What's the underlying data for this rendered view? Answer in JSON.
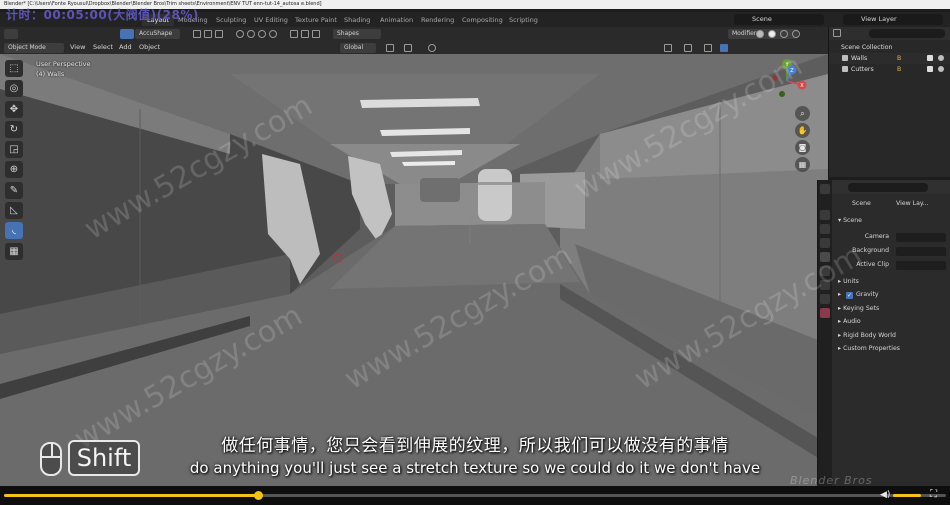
{
  "window": {
    "title": "Blender* [C:\\Users\\Fonte Ryousul\\Dropbox\\Blender\\Blender Bros\\Trim sheets\\Environment\\ENV TUT enn-tut-14_autosa e.blend]",
    "timer": "计时：00:05:00(大阀值)(28%)"
  },
  "workspaces": {
    "tabs": [
      "Layout",
      "Modeling",
      "Sculpting",
      "UV Editing",
      "Texture Paint",
      "Shading",
      "Animation",
      "Rendering",
      "Compositing",
      "Scripting"
    ],
    "active": "Layout",
    "scene_label": "Scene",
    "view_layer_label": "View Layer"
  },
  "viewport_header": {
    "mode": "Object Mode",
    "menus": [
      "View",
      "Select",
      "Add",
      "Object"
    ],
    "accushape": "AccuShape",
    "shapes": "Shapes",
    "orientation": "Global",
    "modifiers": "Modifiers"
  },
  "viewport": {
    "perspective": "User Perspective",
    "selection": "(4) Walls"
  },
  "tools": [
    "select-tool-icon",
    "cursor-tool-icon",
    "move-tool-icon",
    "rotate-tool-icon",
    "scale-tool-icon",
    "transform-tool-icon",
    "annotate-tool-icon",
    "measure-tool-icon",
    "boxcutter-tool-icon",
    "grid-tool-icon"
  ],
  "gizmo": {
    "y": "Y",
    "x": "X",
    "z": "Z"
  },
  "outliner": {
    "search_placeholder": "",
    "collection": "Scene Collection",
    "items": [
      {
        "label": "Walls",
        "badge": "B"
      },
      {
        "label": "Cutters",
        "badge": "B"
      }
    ]
  },
  "properties": {
    "breadcrumb_scene": "Scene",
    "breadcrumb_layer": "View Lay...",
    "section": "Scene",
    "camera_label": "Camera",
    "background_label": "Background",
    "active_clip_label": "Active Clip",
    "panels": [
      "Units",
      "Gravity",
      "Keying Sets",
      "Audio",
      "Rigid Body World",
      "Custom Properties"
    ]
  },
  "overlay": {
    "key_shift": "Shift",
    "subtitle_cn": "做任何事情，您只会看到伸展的纹理，所以我们可以做没有的事情",
    "subtitle_en": "do anything you'll just see a stretch texture so we could do it we don't have",
    "brand": "Blender Bros",
    "watermark": "www.52cgzy.com"
  },
  "player": {
    "progress": 0.27,
    "volume": 0.8
  },
  "colors": {
    "accent_blue": "#4772b3",
    "player_yellow": "#f3c316",
    "timer_purple": "#5b54b8"
  }
}
